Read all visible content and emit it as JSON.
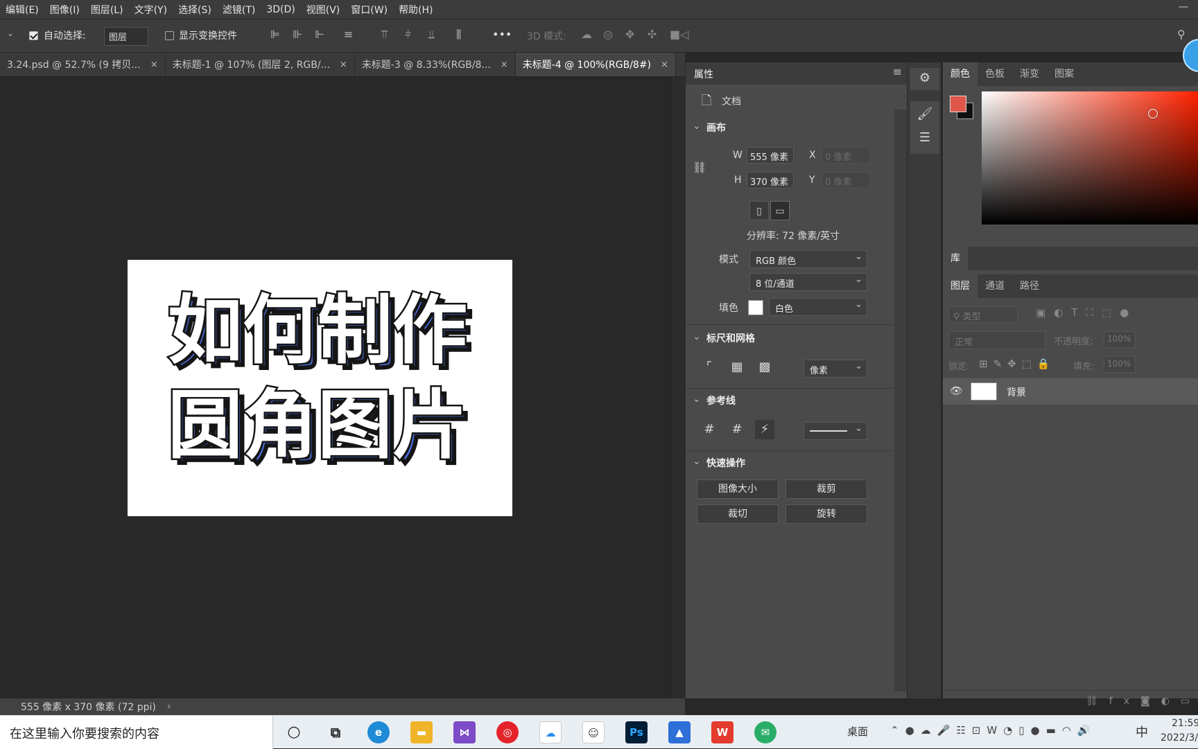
{
  "menu": [
    "编辑(E)",
    "图像(I)",
    "图层(L)",
    "文字(Y)",
    "选择(S)",
    "滤镜(T)",
    "3D(D)",
    "视图(V)",
    "窗口(W)",
    "帮助(H)"
  ],
  "options": {
    "auto_select_label": "自动选择:",
    "auto_select_value": "图层",
    "show_transform_label": "显示变换控件",
    "more": "•••",
    "mode3d_label": "3D 模式:"
  },
  "tabs": [
    {
      "label": "3.24.psd @ 52.7% (9 拷贝...",
      "active": false
    },
    {
      "label": "未标题-1 @ 107% (图层 2, RGB/...",
      "active": false
    },
    {
      "label": "未标题-3 @ 8.33%(RGB/8...",
      "active": false
    },
    {
      "label": "未标题-4 @ 100%(RGB/8#)",
      "active": true
    }
  ],
  "tab_close": "×",
  "canvas": {
    "line1": "如何制作",
    "line2": "圆角图片",
    "stroke_color": "#151515",
    "shadow_color": "#4a6fe0"
  },
  "status": {
    "text": "555 像素 x 370 像素 (72 ppi)",
    "arrow": "›"
  },
  "properties": {
    "title": "属性",
    "doc_label": "文档",
    "canvas_section": "画布",
    "w_label": "W",
    "w_value": "555 像素",
    "h_label": "H",
    "h_value": "370 像素",
    "x_label": "X",
    "x_value": "0 像素",
    "y_label": "Y",
    "y_value": "0 像素",
    "resolution": "分辨率: 72 像素/英寸",
    "mode_label": "模式",
    "mode_value": "RGB 颜色",
    "depth_value": "8 位/通道",
    "fill_label": "填色",
    "fill_value": "白色",
    "rulers_section": "标尺和网格",
    "units_value": "像素",
    "guides_section": "参考线",
    "quick_section": "快速操作",
    "btn_image_size": "图像大小",
    "btn_crop": "裁剪",
    "btn_trim": "裁切",
    "btn_rotate": "旋转"
  },
  "color_tabs": [
    "颜色",
    "色板",
    "渐变",
    "图案"
  ],
  "colors": {
    "foreground": "#e0564a",
    "background": "#111111"
  },
  "library_tab": "库",
  "layer_tabs": [
    "图层",
    "通道",
    "路径"
  ],
  "layers": {
    "filter_placeholder": "类型",
    "blend_mode": "正常",
    "opacity_label": "不透明度:",
    "opacity_value": "100%",
    "lock_label": "锁定:",
    "fill_label": "填充:",
    "fill_value": "100%",
    "layer_name": "背景",
    "footer_fx": "fx"
  },
  "taskbar": {
    "search_placeholder": "在这里输入你要搜索的内容",
    "desktop": "桌面",
    "ime": "中",
    "time": "21:59",
    "date": "2022/3/",
    "ps_label": "Ps"
  }
}
